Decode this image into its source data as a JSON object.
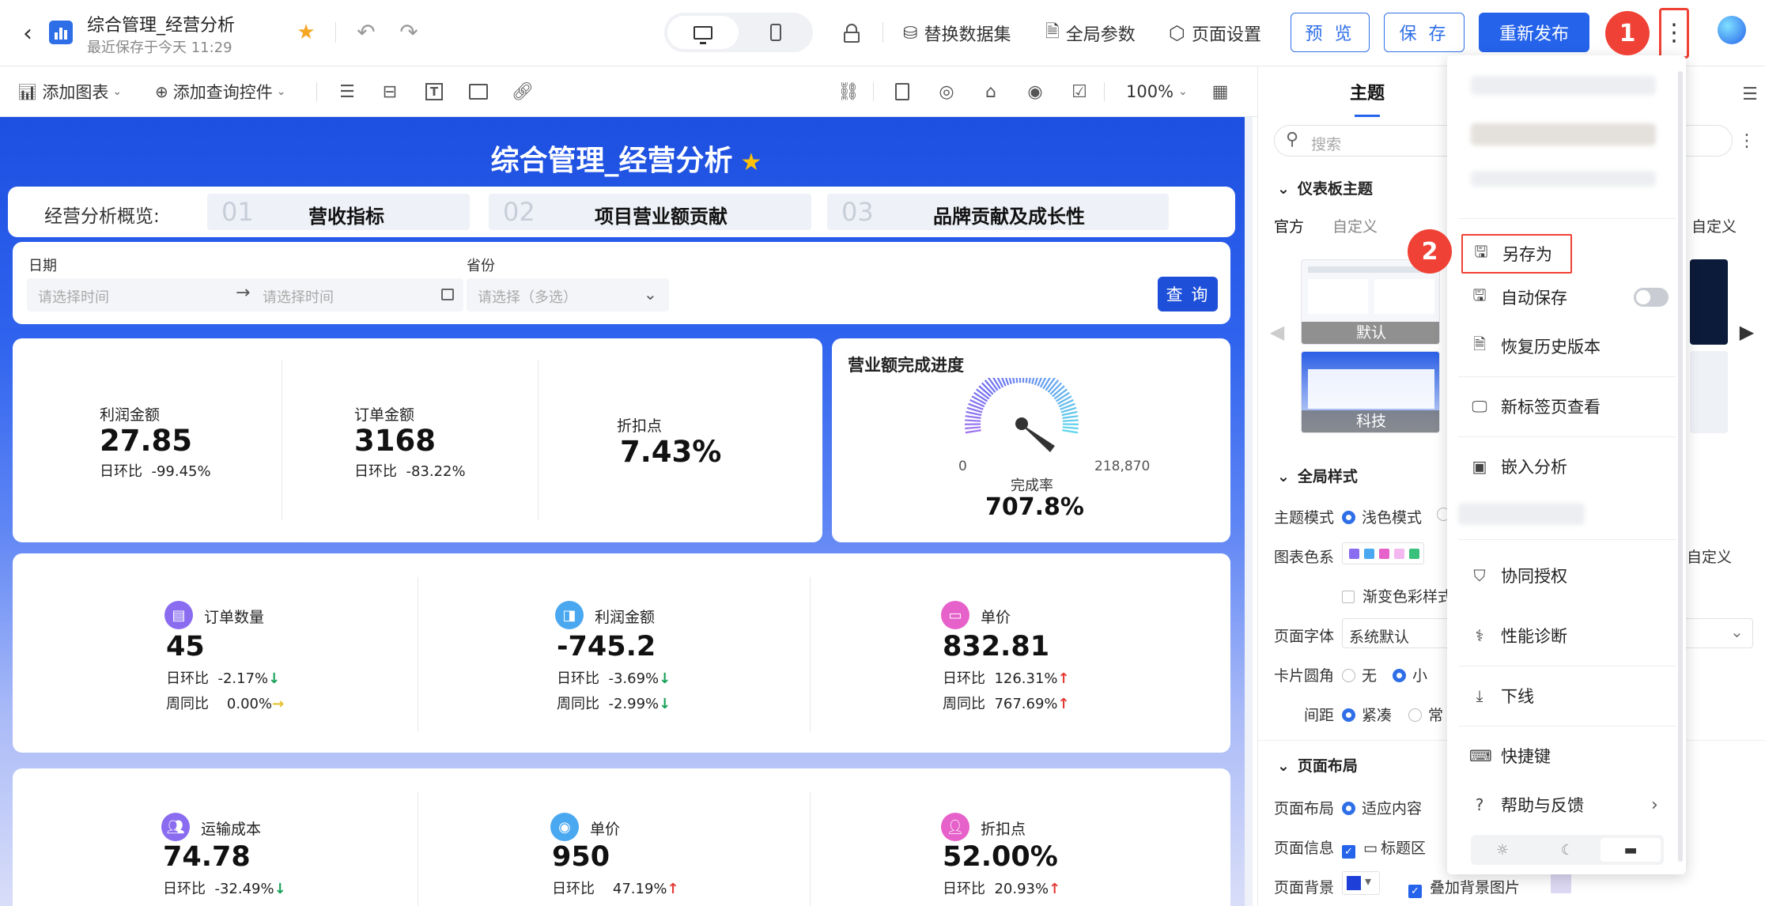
{
  "app": {
    "title": "综合管理_经营分析",
    "subtitle": "最近保存于今天 11:29"
  },
  "header": {
    "replace_dataset": "替换数据集",
    "global_params": "全局参数",
    "page_settings": "页面设置",
    "preview": "预 览",
    "save": "保 存",
    "republish": "重新发布"
  },
  "toolbar": {
    "add_chart": "添加图表",
    "add_query": "添加查询控件",
    "zoom": "100%"
  },
  "dashboard": {
    "title": "综合管理_经营分析",
    "nav_label": "经营分析概览:",
    "tabs": [
      {
        "num": "01",
        "label": "营收指标"
      },
      {
        "num": "02",
        "label": "项目营业额贡献"
      },
      {
        "num": "03",
        "label": "品牌贡献及成长性"
      }
    ],
    "filter": {
      "date_label": "日期",
      "start_ph": "请选择时间",
      "end_ph": "请选择时间",
      "province_label": "省份",
      "province_ph": "请选择（多选）",
      "query": "查 询"
    },
    "kpi1": [
      {
        "label": "利润金额",
        "value": "27.85",
        "sub": "日环比",
        "subval": "-99.45%"
      },
      {
        "label": "订单金额",
        "value": "3168",
        "sub": "日环比",
        "subval": "-83.22%"
      },
      {
        "label": "折扣点",
        "value": "7.43%"
      }
    ],
    "gauge": {
      "title": "营业额完成进度",
      "min": "0",
      "max": "218,870",
      "caption": "完成率",
      "value": "707.8%"
    },
    "kpi2": [
      {
        "label": "订单数量",
        "value": "45",
        "r1": "日环比",
        "r1v": "-2.17%",
        "r2": "周同比",
        "r2v": "0.00%",
        "color": "#8a6cf0"
      },
      {
        "label": "利润金额",
        "value": "-745.2",
        "r1": "日环比",
        "r1v": "-3.69%",
        "r2": "周同比",
        "r2v": "-2.99%",
        "color": "#4aa8f0"
      },
      {
        "label": "单价",
        "value": "832.81",
        "r1": "日环比",
        "r1v": "126.31%",
        "r2": "周同比",
        "r2v": "767.69%",
        "color": "#e661c9"
      }
    ],
    "kpi3": [
      {
        "label": "运输成本",
        "value": "74.78",
        "r1": "日环比",
        "r1v": "-32.49%",
        "color": "#8a6cf0"
      },
      {
        "label": "单价",
        "value": "950",
        "r1": "日环比",
        "r1v": "47.19%",
        "color": "#4aa8f0"
      },
      {
        "label": "折扣点",
        "value": "52.00%",
        "r1": "日环比",
        "r1v": "20.93%",
        "color": "#e661c9"
      }
    ]
  },
  "panel": {
    "tab_theme": "主题",
    "search_ph": "搜索",
    "dash_theme": "仪表板主题",
    "official": "官方",
    "custom": "自定义",
    "custom2": "自定义",
    "theme_default": "默认",
    "theme_tech": "科技",
    "global_style": "全局样式",
    "theme_mode": "主题模式",
    "light": "浅色模式",
    "chart_colors": "图表色系",
    "custom3": "自定义",
    "gradient": "渐变色彩样式",
    "page_font": "页面字体",
    "font_val": "系统默认",
    "card_radius": "卡片圆角",
    "none": "无",
    "small": "小",
    "spacing": "间距",
    "compact": "紧凑",
    "normal": "常",
    "page_layout": "页面布局",
    "layout_label": "页面布局",
    "fit": "适应内容",
    "page_info": "页面信息",
    "title_area": "标题区",
    "page_bg": "页面背景",
    "add_bg": "叠加背景图片"
  },
  "menu": {
    "save_as": "另存为",
    "auto_save": "自动保存",
    "restore": "恢复历史版本",
    "new_tab": "新标签页查看",
    "embed": "嵌入分析",
    "auth": "协同授权",
    "perf": "性能诊断",
    "offline": "下线",
    "shortcut": "快捷键",
    "help": "帮助与反馈"
  },
  "badges": {
    "one": "1",
    "two": "2"
  },
  "colors": {
    "accent": "#2563eb",
    "badge": "#ef4135",
    "palette": [
      "#8a6cf0",
      "#4aa8f0",
      "#e661c9",
      "#f4b8f0",
      "#39c07a"
    ]
  }
}
